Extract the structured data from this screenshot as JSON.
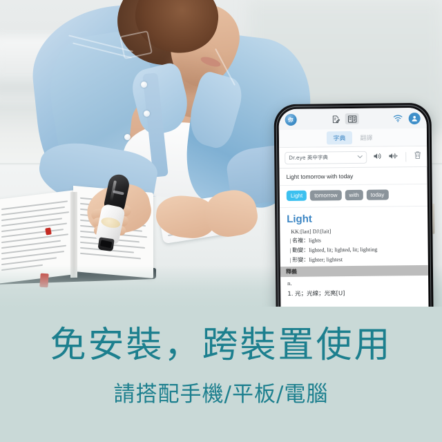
{
  "scene": {
    "description": "woman-scanning-book-with-pen-photo",
    "background_color": "#c9d9d7"
  },
  "phone": {
    "app_top": {
      "logo_label": "Dr",
      "icons": [
        {
          "name": "note-edit-icon",
          "glyph": "edit"
        },
        {
          "name": "split-view-icon",
          "glyph": "columns",
          "active": true
        },
        {
          "name": "wifi-icon",
          "glyph": "wifi"
        },
        {
          "name": "account-icon",
          "glyph": "person"
        }
      ]
    },
    "tabs": [
      {
        "label": "字典",
        "active": true
      },
      {
        "label": "翻譯",
        "active": false
      }
    ],
    "toolbar": {
      "dictionary_select": "Dr.eye 英中字典",
      "chevron": "⌄",
      "speak_icon": "speaker-icon",
      "speak_settings_icon": "speaker-settings-icon",
      "delete_icon": "trash-icon"
    },
    "scanned_sentence": "Light tomorrow with today",
    "word_chips": [
      {
        "text": "Light",
        "selected": true
      },
      {
        "text": "tomorrow",
        "selected": false
      },
      {
        "text": "with",
        "selected": false
      },
      {
        "text": "today",
        "selected": false
      }
    ],
    "entry": {
      "headword": "Light",
      "phonetics": "KK:[laɪt]  DJ:[lait]",
      "inflections": [
        "| 名複：lights",
        "| 動變：lighted, lit; lighted, lit; lighting",
        "| 形變：lighter; lightest"
      ],
      "section_header": "釋義",
      "part_of_speech": "n.",
      "senses": [
        "1.  光；光線；光亮[U]"
      ]
    },
    "accent_color": "#3c86c4",
    "chip_selected_color": "#3cc0ef"
  },
  "caption": {
    "headline": "免安裝，跨裝置使用",
    "subline": "請搭配手機/平板/電腦",
    "text_color": "#1c7f8e"
  }
}
